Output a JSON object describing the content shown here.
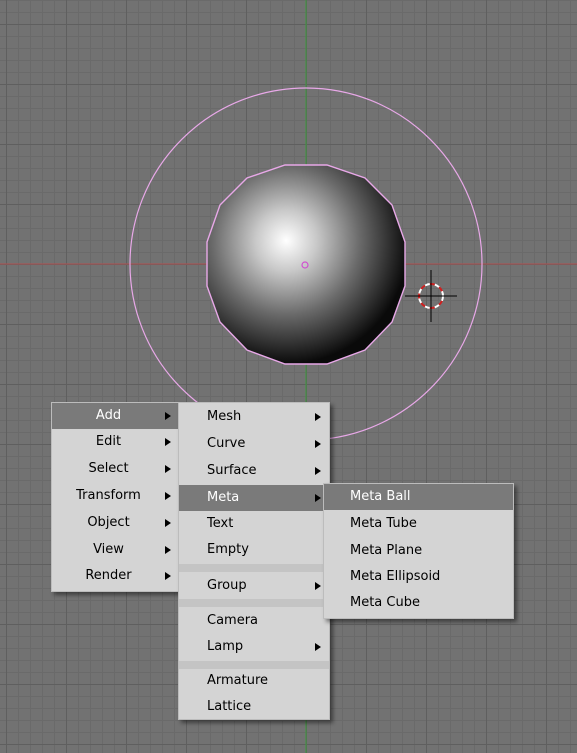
{
  "colors": {
    "viewport_bg": "#727272",
    "grid_major": "#5f5f5f",
    "x_axis": "#b05050",
    "y_axis": "#3c9a3c",
    "selection_outline": "#e8a8e8",
    "menu_bg": "#d4d4d4",
    "menu_active": "#7a7a7a"
  },
  "scene": {
    "object": "metaball-sphere",
    "cursor_icon": "3d-cursor-icon"
  },
  "main_menu": {
    "items": [
      {
        "label": "Add",
        "submenu": true,
        "active": true
      },
      {
        "label": "Edit",
        "submenu": true
      },
      {
        "label": "Select",
        "submenu": true
      },
      {
        "label": "Transform",
        "submenu": true
      },
      {
        "label": "Object",
        "submenu": true
      },
      {
        "label": "View",
        "submenu": true
      },
      {
        "label": "Render",
        "submenu": true
      }
    ]
  },
  "add_menu": {
    "items": [
      {
        "label": "Mesh",
        "submenu": true
      },
      {
        "label": "Curve",
        "submenu": true
      },
      {
        "label": "Surface",
        "submenu": true
      },
      {
        "label": "Meta",
        "submenu": true,
        "active": true
      },
      {
        "label": "Text"
      },
      {
        "label": "Empty"
      },
      {
        "label": "Group",
        "submenu": true
      },
      {
        "label": "Camera"
      },
      {
        "label": "Lamp",
        "submenu": true
      },
      {
        "label": "Armature"
      },
      {
        "label": "Lattice"
      }
    ]
  },
  "meta_menu": {
    "items": [
      {
        "label": "Meta Ball",
        "active": true
      },
      {
        "label": "Meta Tube"
      },
      {
        "label": "Meta Plane"
      },
      {
        "label": "Meta Ellipsoid"
      },
      {
        "label": "Meta Cube"
      }
    ]
  }
}
